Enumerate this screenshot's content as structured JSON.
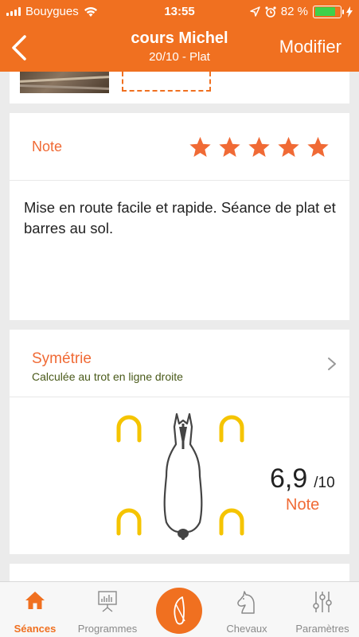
{
  "status_bar": {
    "carrier": "Bouygues",
    "time": "13:55",
    "battery": "82 %",
    "battery_level": 0.82
  },
  "nav": {
    "title": "cours Michel",
    "subtitle": "20/10 - Plat",
    "edit_label": "Modifier"
  },
  "note_card": {
    "label": "Note",
    "stars": 5,
    "comment": "Mise en route facile et rapide. Séance de plat et barres au sol."
  },
  "symmetry_card": {
    "title": "Symétrie",
    "subtitle": "Calculée au trot en ligne droite",
    "score": "6,9",
    "score_max": "/10",
    "score_label": "Note"
  },
  "tabs": [
    {
      "label": "Séances",
      "icon": "home-icon",
      "active": true
    },
    {
      "label": "Programmes",
      "icon": "presentation-icon",
      "active": false
    },
    {
      "label": "",
      "icon": "whip-icon",
      "active": false
    },
    {
      "label": "Chevaux",
      "icon": "horse-head-icon",
      "active": false
    },
    {
      "label": "Paramètres",
      "icon": "sliders-icon",
      "active": false
    }
  ],
  "colors": {
    "brand": "#f07020",
    "accent_text": "#f06a35",
    "horseshoe": "#f5c400",
    "battery": "#3fd04a"
  }
}
